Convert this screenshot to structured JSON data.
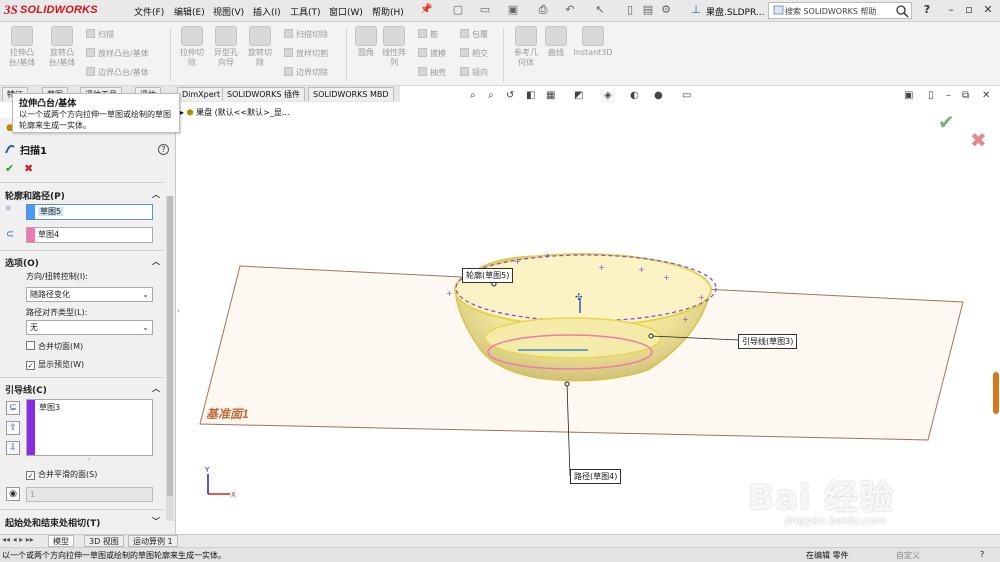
{
  "app": {
    "logo_ds": "3S",
    "logo_name": "SOLIDWORKS",
    "document_title": "果盘.SLDPR...",
    "search_placeholder": "搜索 SOLIDWORKS 帮助",
    "help_glyph": "?"
  },
  "menu": [
    "文件(F)",
    "编辑(E)",
    "视图(V)",
    "插入(I)",
    "工具(T)",
    "窗口(W)",
    "帮助(H)"
  ],
  "ribbon": {
    "big_buttons": [
      {
        "label": "拉伸凸\n台/基体"
      },
      {
        "label": "旋转凸\n台/基体"
      },
      {
        "label": "拉伸切\n除"
      },
      {
        "label": "异型孔\n向导"
      },
      {
        "label": "旋转切\n除"
      },
      {
        "label": "线性阵\n列"
      },
      {
        "label": "参考几\n何体"
      },
      {
        "label": "曲线"
      },
      {
        "label": "Instant3D"
      }
    ],
    "small_buttons": [
      "扫描",
      "放样凸台/基体",
      "边界凸台/基体",
      "扫描切除",
      "放样切割",
      "边界切除",
      "圆角",
      "筋",
      "拔模",
      "抽壳",
      "包覆",
      "相交",
      "镜向"
    ]
  },
  "tabs": [
    "特征",
    "草图",
    "评估工具",
    "评估",
    "DimXpert",
    "SOLIDWORKS 插件",
    "SOLIDWORKS MBD"
  ],
  "tooltip": {
    "title": "拉伸凸台/基体",
    "text": "以一个或两个方向拉伸一草图或绘制的草图轮廓来生成一实体。"
  },
  "property_manager": {
    "title": "扫描1",
    "help": "?",
    "ok": "✔",
    "cancel": "✖",
    "sections": {
      "profile_path": "轮廓和路径(P)",
      "options": "选项(O)",
      "guides": "引导线(C)",
      "tangency": "起始处和结束处相切(T)"
    },
    "profile_field": "草图5",
    "path_field": "草图4",
    "orientation_label": "方向/扭转控制(I):",
    "orientation_value": "随路径变化",
    "path_align_label": "路径对齐类型(L):",
    "path_align_value": "无",
    "merge_tangent": "合并切面(M)",
    "show_preview": "显示预览(W)",
    "guide_item": "草图3",
    "merge_smooth": "合并平滑的面(S)",
    "spin_value": "1",
    "colors": {
      "profile": "#4a9bf0",
      "path": "#f07ab0",
      "guide": "#8a2be2"
    }
  },
  "feature_tree": {
    "item": "果盘 (默认<<默认>_显..."
  },
  "viewport": {
    "plane_label": "基准面1",
    "callouts": {
      "profile": "轮廓(草图5)",
      "guide": "引导线(草图3)",
      "path": "路径(草图4)"
    },
    "triad": {
      "x": "X",
      "y": "Y"
    }
  },
  "bottom_tabs": [
    "模型",
    "3D 视图",
    "运动算例 1"
  ],
  "status": {
    "message": "以一个或两个方向拉伸一草图或绘制的草图轮廓来生成一实体。",
    "mode": "在编辑 零件",
    "custom": "自定义"
  },
  "watermark": {
    "text": "Bai  经验",
    "url": "jingyan.baidu.com"
  }
}
